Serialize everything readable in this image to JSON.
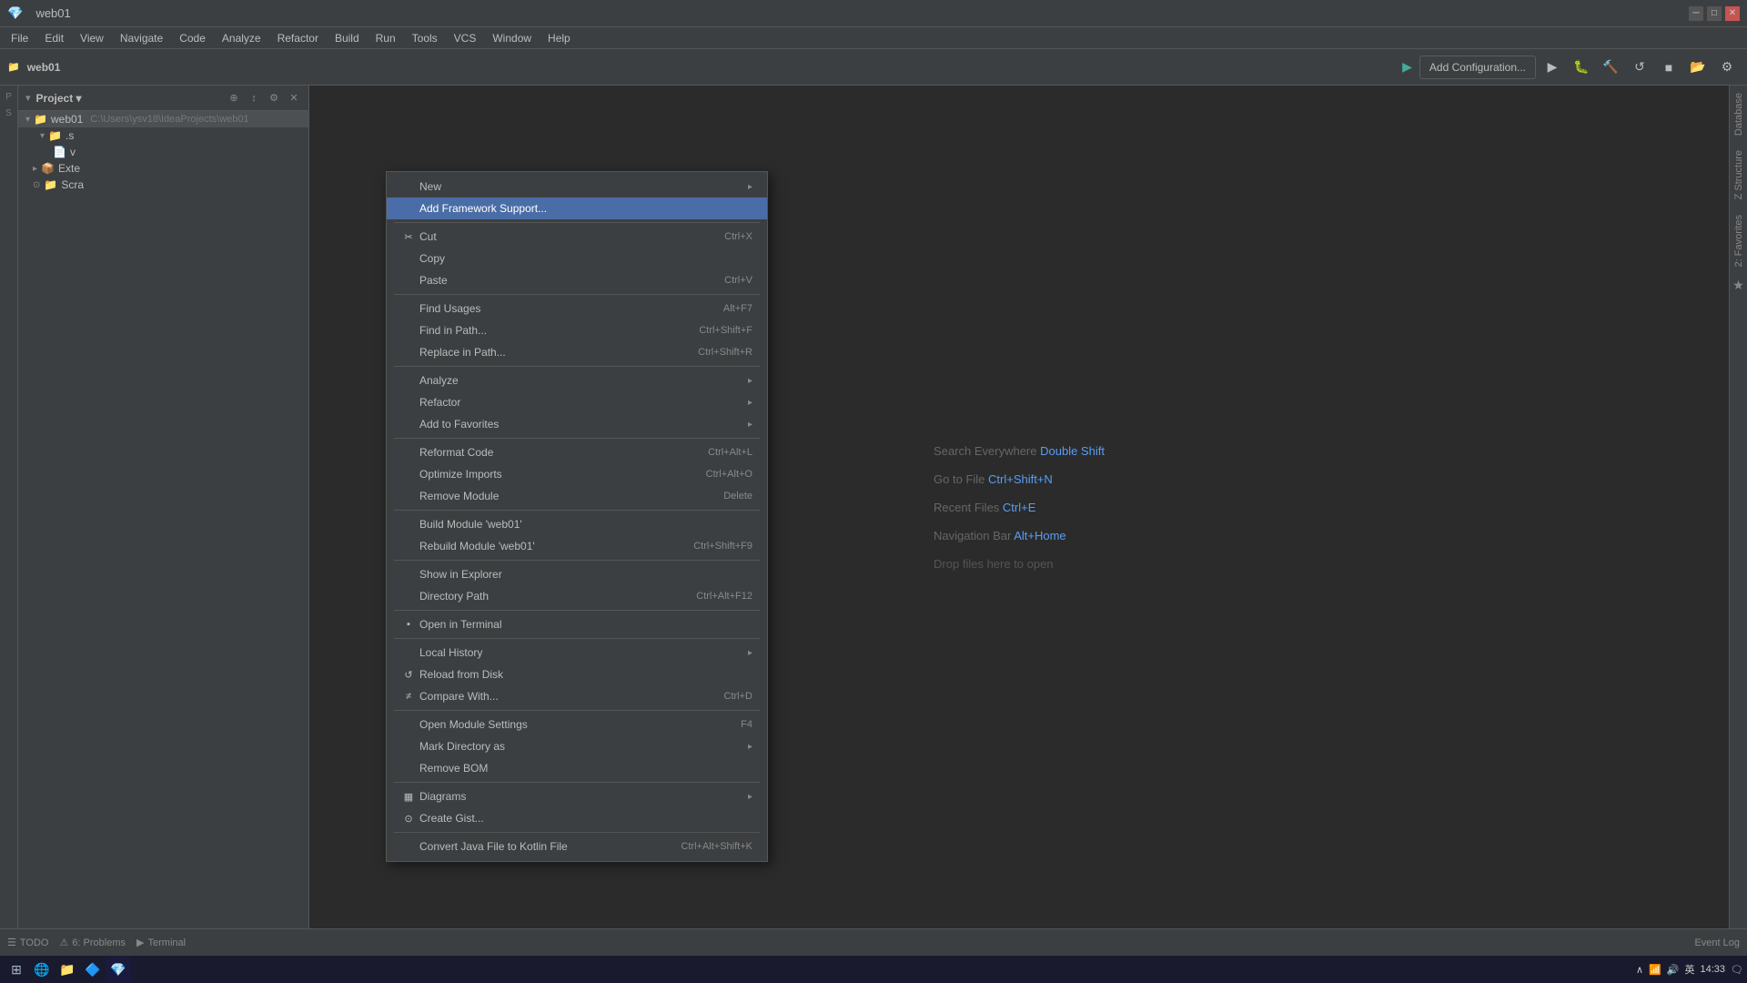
{
  "titleBar": {
    "title": "web01",
    "minBtn": "─",
    "maxBtn": "□",
    "closeBtn": "✕"
  },
  "menuBar": {
    "items": [
      "File",
      "Edit",
      "View",
      "Navigate",
      "Code",
      "Analyze",
      "Refactor",
      "Build",
      "Run",
      "Tools",
      "VCS",
      "Window",
      "Help"
    ]
  },
  "toolbar": {
    "addConfigLabel": "Add Configuration...",
    "projectName": "web01"
  },
  "projectPanel": {
    "title": "Project",
    "rootItem": "web01",
    "rootPath": "C:\\Users\\ysv18\\IdeaProjects\\web01",
    "items": [
      {
        "label": "web01",
        "path": "C:\\Users\\ysv18\\IdeaProjects\\web01",
        "level": 0
      },
      {
        "label": ".s",
        "level": 1
      },
      {
        "label": "v",
        "level": 1
      },
      {
        "label": "Exte",
        "level": 1
      },
      {
        "label": "Scra",
        "level": 1
      }
    ]
  },
  "editorHints": [
    {
      "label": "Search Everywhere",
      "key": "Double Shift"
    },
    {
      "label": "Go to File",
      "key": "Ctrl+Shift+N"
    },
    {
      "label": "Recent Files",
      "key": "Ctrl+E"
    },
    {
      "label": "Navigation Bar",
      "key": "Alt+Home"
    },
    {
      "label": "Drop files here to open",
      "key": ""
    }
  ],
  "contextMenu": {
    "items": [
      {
        "id": "new",
        "label": "New",
        "shortcut": "",
        "hasArrow": true,
        "icon": ""
      },
      {
        "id": "add-framework",
        "label": "Add Framework Support...",
        "shortcut": "",
        "hasArrow": false,
        "icon": "",
        "highlighted": true
      },
      {
        "id": "sep1",
        "type": "separator"
      },
      {
        "id": "cut",
        "label": "Cut",
        "shortcut": "Ctrl+X",
        "hasArrow": false,
        "icon": "✂"
      },
      {
        "id": "copy",
        "label": "Copy",
        "shortcut": "",
        "hasArrow": false,
        "icon": ""
      },
      {
        "id": "paste",
        "label": "Paste",
        "shortcut": "Ctrl+V",
        "hasArrow": false,
        "icon": ""
      },
      {
        "id": "sep2",
        "type": "separator"
      },
      {
        "id": "find-usages",
        "label": "Find Usages",
        "shortcut": "Alt+F7",
        "hasArrow": false,
        "icon": ""
      },
      {
        "id": "find-in-path",
        "label": "Find in Path...",
        "shortcut": "Ctrl+Shift+F",
        "hasArrow": false,
        "icon": ""
      },
      {
        "id": "replace-in-path",
        "label": "Replace in Path...",
        "shortcut": "Ctrl+Shift+R",
        "hasArrow": false,
        "icon": ""
      },
      {
        "id": "sep3",
        "type": "separator"
      },
      {
        "id": "analyze",
        "label": "Analyze",
        "shortcut": "",
        "hasArrow": true,
        "icon": ""
      },
      {
        "id": "refactor",
        "label": "Refactor",
        "shortcut": "",
        "hasArrow": true,
        "icon": ""
      },
      {
        "id": "add-to-fav",
        "label": "Add to Favorites",
        "shortcut": "",
        "hasArrow": true,
        "icon": ""
      },
      {
        "id": "sep4",
        "type": "separator"
      },
      {
        "id": "reformat-code",
        "label": "Reformat Code",
        "shortcut": "Ctrl+Alt+L",
        "hasArrow": false,
        "icon": ""
      },
      {
        "id": "optimize-imports",
        "label": "Optimize Imports",
        "shortcut": "Ctrl+Alt+O",
        "hasArrow": false,
        "icon": ""
      },
      {
        "id": "remove-module",
        "label": "Remove Module",
        "shortcut": "Delete",
        "hasArrow": false,
        "icon": ""
      },
      {
        "id": "sep5",
        "type": "separator"
      },
      {
        "id": "build-module",
        "label": "Build Module 'web01'",
        "shortcut": "",
        "hasArrow": false,
        "icon": ""
      },
      {
        "id": "rebuild-module",
        "label": "Rebuild Module 'web01'",
        "shortcut": "Ctrl+Shift+F9",
        "hasArrow": false,
        "icon": ""
      },
      {
        "id": "sep6",
        "type": "separator"
      },
      {
        "id": "show-explorer",
        "label": "Show in Explorer",
        "shortcut": "",
        "hasArrow": false,
        "icon": ""
      },
      {
        "id": "directory-path",
        "label": "Directory Path",
        "shortcut": "Ctrl+Alt+F12",
        "hasArrow": false,
        "icon": ""
      },
      {
        "id": "sep7",
        "type": "separator"
      },
      {
        "id": "open-terminal",
        "label": "Open in Terminal",
        "shortcut": "",
        "hasArrow": false,
        "icon": "▪"
      },
      {
        "id": "sep8",
        "type": "separator"
      },
      {
        "id": "local-history",
        "label": "Local History",
        "shortcut": "",
        "hasArrow": true,
        "icon": ""
      },
      {
        "id": "reload-disk",
        "label": "Reload from Disk",
        "shortcut": "",
        "hasArrow": false,
        "icon": "↺"
      },
      {
        "id": "compare-with",
        "label": "Compare With...",
        "shortcut": "Ctrl+D",
        "hasArrow": false,
        "icon": "≠"
      },
      {
        "id": "sep9",
        "type": "separator"
      },
      {
        "id": "open-module-settings",
        "label": "Open Module Settings",
        "shortcut": "F4",
        "hasArrow": false,
        "icon": ""
      },
      {
        "id": "mark-directory",
        "label": "Mark Directory as",
        "shortcut": "",
        "hasArrow": true,
        "icon": ""
      },
      {
        "id": "remove-bom",
        "label": "Remove BOM",
        "shortcut": "",
        "hasArrow": false,
        "icon": ""
      },
      {
        "id": "sep10",
        "type": "separator"
      },
      {
        "id": "diagrams",
        "label": "Diagrams",
        "shortcut": "",
        "hasArrow": true,
        "icon": "▦"
      },
      {
        "id": "create-gist",
        "label": "Create Gist...",
        "shortcut": "",
        "hasArrow": false,
        "icon": "⊙"
      },
      {
        "id": "sep11",
        "type": "separator"
      },
      {
        "id": "convert-java",
        "label": "Convert Java File to Kotlin File",
        "shortcut": "Ctrl+Alt+Shift+K",
        "hasArrow": false,
        "icon": ""
      }
    ]
  },
  "statusBar": {
    "tabs": [
      "TODO",
      "6: Problems",
      "Terminal"
    ],
    "right": "Event Log"
  },
  "taskbar": {
    "time": "14:33",
    "lang": "英",
    "items": [
      "⊞",
      "🌐",
      "📁",
      "🔷",
      "💎"
    ]
  }
}
